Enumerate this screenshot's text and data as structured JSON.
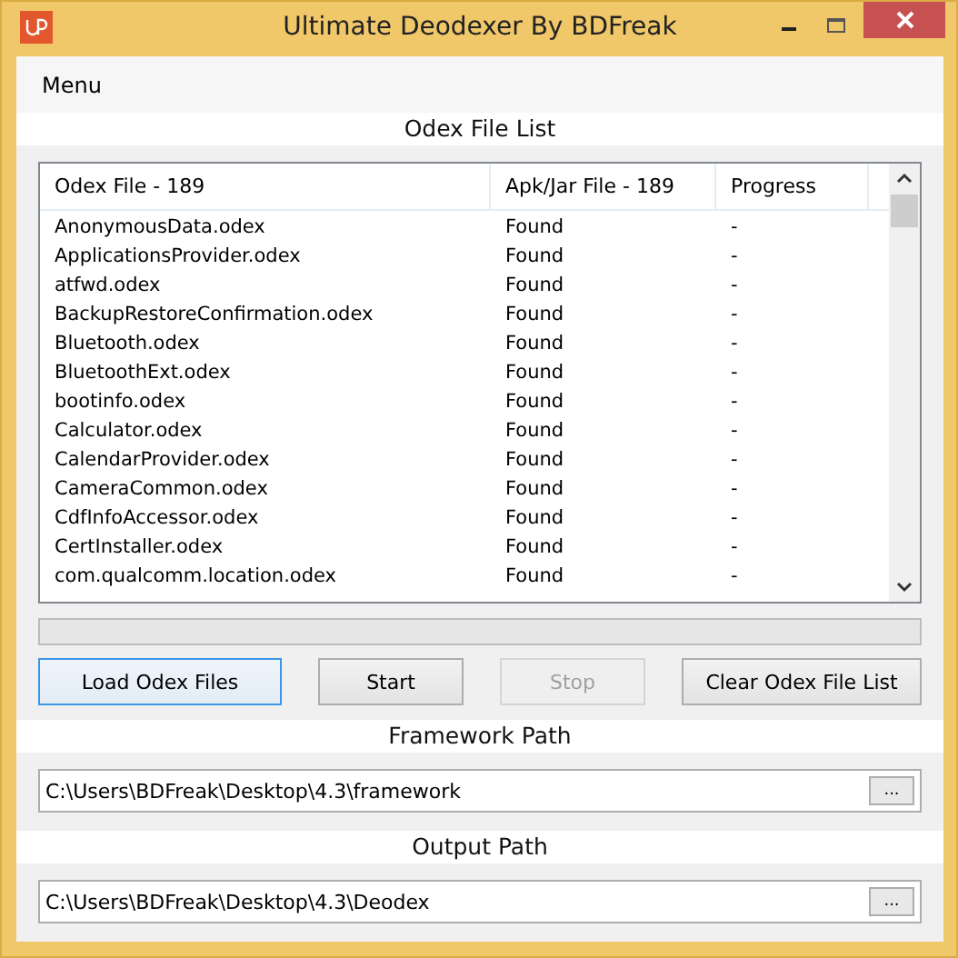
{
  "window": {
    "title": "Ultimate Deodexer By BDFreak"
  },
  "menu": [
    "Menu"
  ],
  "odex_list": {
    "title": "Odex File List",
    "columns": [
      "Odex File - 189",
      "Apk/Jar File - 189",
      "Progress"
    ],
    "rows": [
      [
        "AnonymousData.odex",
        "Found",
        "-"
      ],
      [
        "ApplicationsProvider.odex",
        "Found",
        "-"
      ],
      [
        "atfwd.odex",
        "Found",
        "-"
      ],
      [
        "BackupRestoreConfirmation.odex",
        "Found",
        "-"
      ],
      [
        "Bluetooth.odex",
        "Found",
        "-"
      ],
      [
        "BluetoothExt.odex",
        "Found",
        "-"
      ],
      [
        "bootinfo.odex",
        "Found",
        "-"
      ],
      [
        "Calculator.odex",
        "Found",
        "-"
      ],
      [
        "CalendarProvider.odex",
        "Found",
        "-"
      ],
      [
        "CameraCommon.odex",
        "Found",
        "-"
      ],
      [
        "CdfInfoAccessor.odex",
        "Found",
        "-"
      ],
      [
        "CertInstaller.odex",
        "Found",
        "-"
      ],
      [
        "com.qualcomm.location.odex",
        "Found",
        "-"
      ]
    ]
  },
  "buttons": [
    {
      "label": "Load Odex Files",
      "focused": true,
      "disabled": false
    },
    {
      "label": "Start",
      "focused": false,
      "disabled": false
    },
    {
      "label": "Stop",
      "focused": false,
      "disabled": true
    },
    {
      "label": "Clear Odex File List",
      "focused": false,
      "disabled": false
    }
  ],
  "paths": [
    {
      "title": "Framework Path",
      "value": "C:\\Users\\BDFreak\\Desktop\\4.3\\framework",
      "browse": "..."
    },
    {
      "title": "Output Path",
      "value": "C:\\Users\\BDFreak\\Desktop\\4.3\\Deodex",
      "browse": "..."
    }
  ]
}
